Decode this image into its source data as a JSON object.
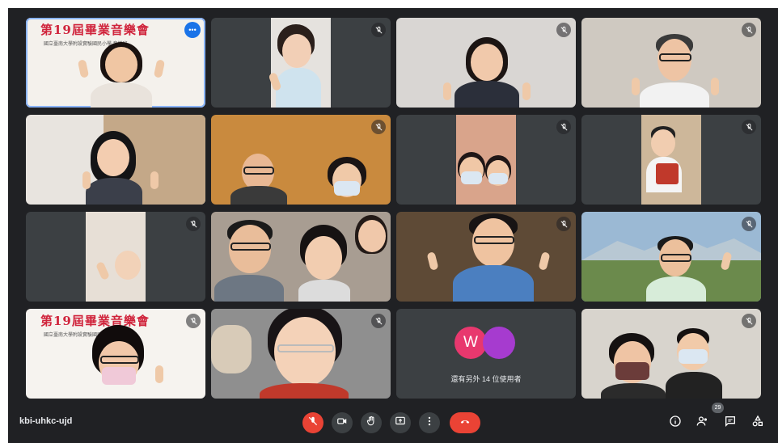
{
  "meeting": {
    "code": "kbi-uhkc-ujd",
    "participant_count": "29"
  },
  "tiles": {
    "poster_title": "第19屆畢業音樂會",
    "poster_sub": "國立臺南大學附設實驗國民小學 音樂班",
    "others_label": "還有另外 14 位使用者",
    "others_avatar_letter": "W"
  },
  "controls": {
    "mic": "mic-off-icon",
    "camera": "camera-icon",
    "raise_hand": "raise-hand-icon",
    "present": "present-screen-icon",
    "more": "more-options-icon",
    "end_call": "end-call-icon"
  },
  "right_controls": {
    "info": "info-icon",
    "people": "people-icon",
    "chat": "chat-icon",
    "activities": "activities-icon"
  },
  "colors": {
    "background": "#202124",
    "tile": "#3c4043",
    "accent": "#8ab4f8",
    "danger": "#ea4335",
    "avatar_w": "#e8386e",
    "avatar_p": "#a63bcf"
  }
}
